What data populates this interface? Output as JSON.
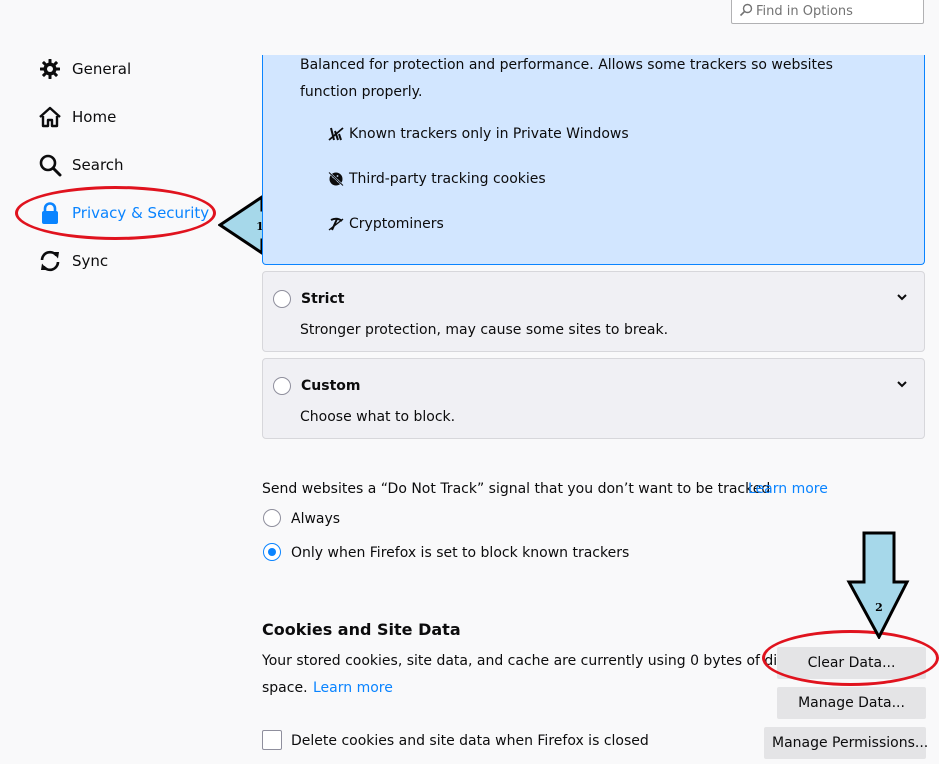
{
  "search": {
    "placeholder": "Find in Options"
  },
  "sidebar": {
    "items": [
      {
        "label": "General",
        "icon": "gear-icon"
      },
      {
        "label": "Home",
        "icon": "home-icon"
      },
      {
        "label": "Search",
        "icon": "search-icon"
      },
      {
        "label": "Privacy & Security",
        "icon": "lock-icon",
        "selected": true
      },
      {
        "label": "Sync",
        "icon": "sync-icon"
      }
    ]
  },
  "blocking": {
    "standard": {
      "description": "Balanced for protection and performance. Allows some trackers so websites function properly.",
      "items": [
        {
          "label": "Known trackers only in Private Windows",
          "icon": "tracker-icon"
        },
        {
          "label": "Third-party tracking cookies",
          "icon": "cookie-icon"
        },
        {
          "label": "Cryptominers",
          "icon": "cryptominer-icon"
        }
      ]
    },
    "strict": {
      "title": "Strict",
      "description": "Stronger protection, may cause some sites to break."
    },
    "custom": {
      "title": "Custom",
      "description": "Choose what to block."
    }
  },
  "dnt": {
    "text": "Send websites a “Do Not Track” signal that you don’t want to be tracked",
    "learn_more": "Learn more",
    "options": [
      {
        "label": "Always",
        "checked": false
      },
      {
        "label": "Only when Firefox is set to block known trackers",
        "checked": true
      }
    ]
  },
  "cookies": {
    "heading": "Cookies and Site Data",
    "description_line1": "Your stored cookies, site data, and cache are currently using 0 bytes of disk",
    "description_line2": "space.",
    "learn_more": "Learn more",
    "clear_data_label": "Clear Data...",
    "manage_data_label": "Manage Data...",
    "manage_permissions_label": "Manage Permissions...",
    "delete_on_close_label": "Delete cookies and site data when Firefox is closed",
    "delete_on_close_checked": false
  },
  "annotations": {
    "arrow1_label": "1",
    "arrow2_label": "2",
    "highlight_color": "#e0131e",
    "arrow_fill": "#a6d8ea"
  },
  "colors": {
    "accent": "#0a84ff",
    "selected_panel": "#d2e6ff",
    "background": "#f9f9fa"
  }
}
